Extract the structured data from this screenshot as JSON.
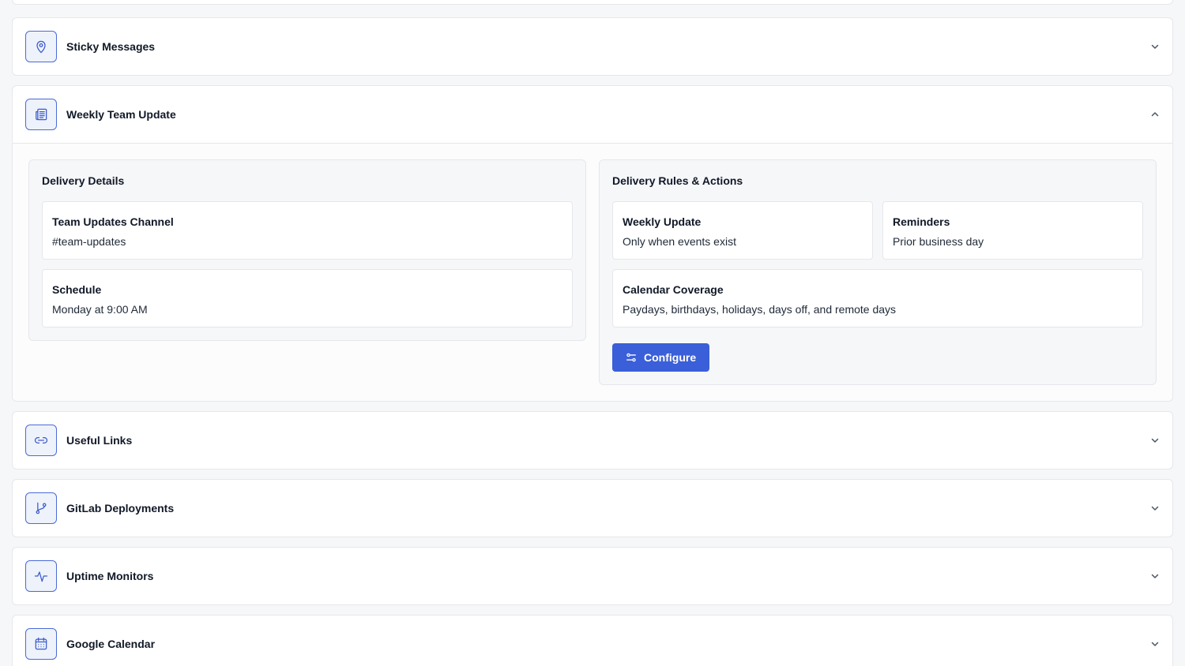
{
  "sections": [
    {
      "title": "Sticky Messages",
      "icon": "pin-icon",
      "expanded": false
    },
    {
      "title": "Weekly Team Update",
      "icon": "newspaper-icon",
      "expanded": true
    },
    {
      "title": "Useful Links",
      "icon": "link-icon",
      "expanded": false
    },
    {
      "title": "GitLab Deployments",
      "icon": "git-branch-icon",
      "expanded": false
    },
    {
      "title": "Uptime Monitors",
      "icon": "activity-icon",
      "expanded": false
    },
    {
      "title": "Google Calendar",
      "icon": "calendar-icon",
      "expanded": false
    }
  ],
  "weekly_update": {
    "delivery_details": {
      "title": "Delivery Details",
      "channel_label": "Team Updates Channel",
      "channel_value": "#team-updates",
      "schedule_label": "Schedule",
      "schedule_value": "Monday at 9:00 AM"
    },
    "delivery_rules": {
      "title": "Delivery Rules & Actions",
      "weekly_label": "Weekly Update",
      "weekly_value": "Only when events exist",
      "reminders_label": "Reminders",
      "reminders_value": "Prior business day",
      "coverage_label": "Calendar Coverage",
      "coverage_value": "Paydays, birthdays, holidays, days off, and remote days",
      "configure_label": "Configure"
    }
  },
  "colors": {
    "accent": "#3a5fd9",
    "icon_stroke": "#3b5bcc",
    "icon_bg": "#eef2fb",
    "border": "#e5e7eb"
  }
}
